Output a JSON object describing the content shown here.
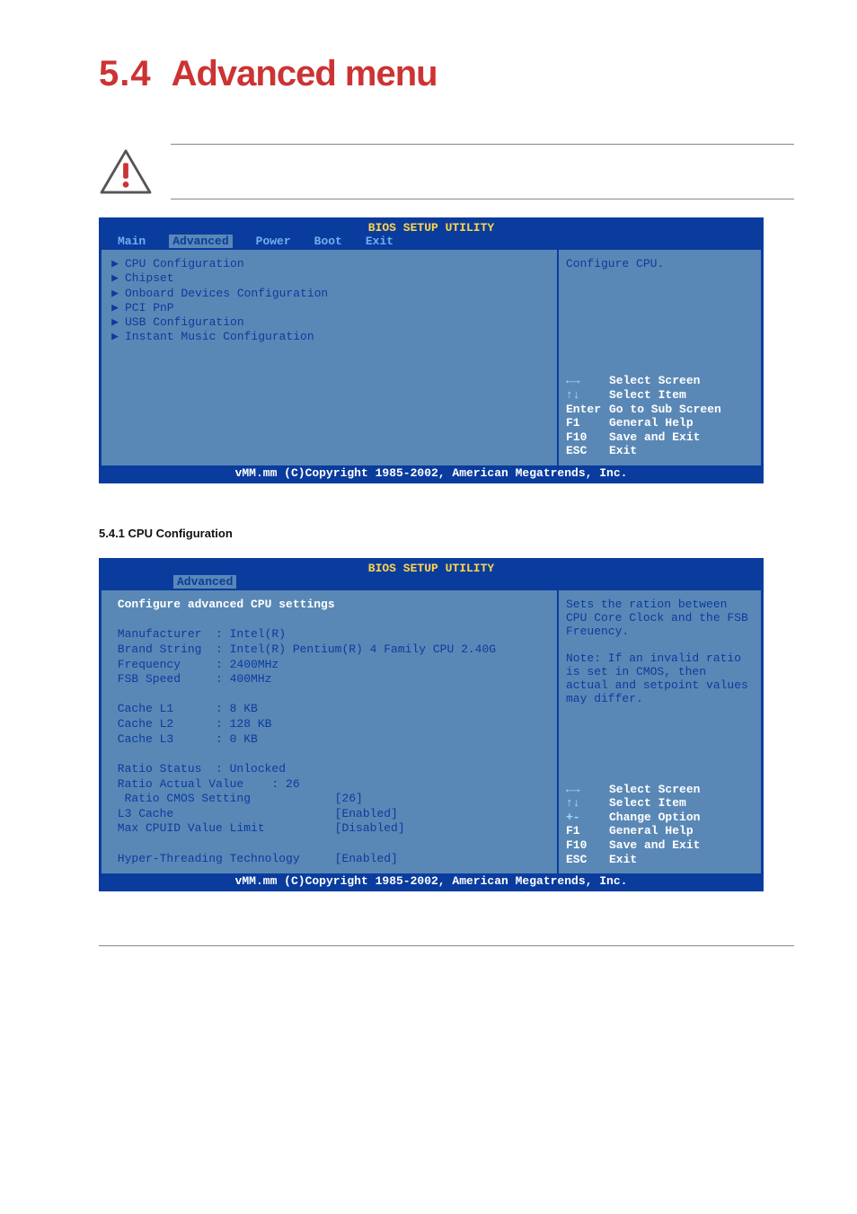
{
  "heading": {
    "num": "5.4",
    "title": "Advanced menu"
  },
  "bios1": {
    "title": "BIOS SETUP UTILITY",
    "tabs": [
      "Main",
      "Advanced",
      "Power",
      "Boot",
      "Exit"
    ],
    "activeTab": "Advanced",
    "menu": [
      "CPU Configuration",
      "Chipset",
      "Onboard Devices Configuration",
      "PCI PnP",
      "USB Configuration",
      "Instant Music Configuration"
    ],
    "helpTop": "Configure CPU.",
    "keys": [
      {
        "k": "←→",
        "l": "Select Screen"
      },
      {
        "k": "↑↓",
        "l": "Select Item"
      },
      {
        "k": "Enter",
        "l": "Go to Sub Screen"
      },
      {
        "k": "F1",
        "l": "General Help"
      },
      {
        "k": "F10",
        "l": "Save and Exit"
      },
      {
        "k": "ESC",
        "l": "Exit"
      }
    ],
    "footer": "vMM.mm (C)Copyright 1985-2002, American Megatrends, Inc."
  },
  "subheading": "5.4.1 CPU Configuration",
  "bios2": {
    "title": "BIOS SETUP UTILITY",
    "tabs": [
      "Advanced"
    ],
    "header": "Configure advanced CPU settings",
    "fields": {
      "Manufacturer": "Intel(R)",
      "Brand String": "Intel(R) Pentium(R) 4 Family CPU 2.40G",
      "Frequency": "2400MHz",
      "FSB Speed": "400MHz",
      "Cache L1": "8 KB",
      "Cache L2": "128 KB",
      "Cache L3": "0 KB",
      "Ratio Status": "Unlocked",
      "Ratio Actual Value": "26",
      "Ratio CMOS Setting": "[26]",
      "L3 Cache": "[Enabled]",
      "Max CPUID Value Limit": "[Disabled]",
      "Hyper-Threading Technology": "[Enabled]"
    },
    "helpTop": "Sets the ration between CPU Core Clock and the FSB Freuency.\n\nNote: If an invalid ratio is set in CMOS, then actual and setpoint values may differ.",
    "keys": [
      {
        "k": "←→",
        "l": "Select Screen"
      },
      {
        "k": "↑↓",
        "l": "Select Item"
      },
      {
        "k": "+-",
        "l": "Change Option"
      },
      {
        "k": "F1",
        "l": "General Help"
      },
      {
        "k": "F10",
        "l": "Save and Exit"
      },
      {
        "k": "ESC",
        "l": "Exit"
      }
    ],
    "footer": "vMM.mm (C)Copyright 1985-2002, American Megatrends, Inc."
  }
}
